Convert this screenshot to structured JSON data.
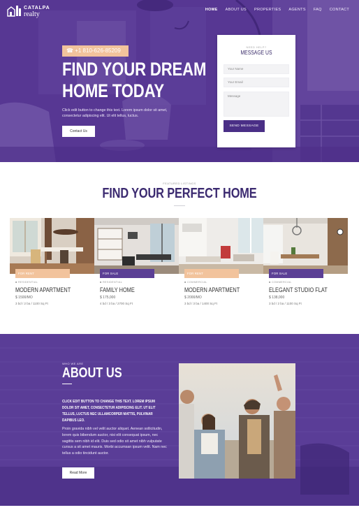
{
  "colors": {
    "brand_purple": "#4a2f86",
    "accent_peach": "#f2c39c",
    "tag_purple": "#5b3f95"
  },
  "header": {
    "logo_top": "CATALPA",
    "logo_bottom": "realty",
    "logo_icon": "house-skyline-icon",
    "nav": [
      "HOME",
      "ABOUT US",
      "PROPERTIES",
      "AGENTS",
      "FAQ",
      "CONTACT"
    ]
  },
  "hero": {
    "phone": "+1 810-626-85209",
    "title_line1": "FIND YOUR DREAM",
    "title_line2": "HOME TODAY",
    "text": "Click edit button to change this text. Lorem ipsum dolor sit amet, consectetur adipiscing elit. Ut elit tellus, luctus.",
    "button": "Contact Us"
  },
  "contact_card": {
    "kicker": "NEED HELP?",
    "title": "MESSAGE US",
    "name_placeholder": "Your Name",
    "email_placeholder": "Your Email",
    "message_placeholder": "Message",
    "send": "SEND MESSAGE"
  },
  "listings": {
    "kicker": "FEATURED LISTINGS",
    "title": "FIND YOUR PERFECT HOME",
    "cards": [
      {
        "tag": "FOR RENT",
        "type": "RESIDENTIAL",
        "name": "MODERN APARTMENT",
        "price": "$ 1500/MO",
        "specs": "3 bd / 2 ba / 1100 Sq Ft",
        "tag_color": "#f2c39c"
      },
      {
        "tag": "FOR SALE",
        "type": "RESIDENTIAL",
        "name": "FAMILY HOME",
        "price": "$ 175,000",
        "specs": "4 bd / 3 ba / 2700 Sq Ft",
        "tag_color": "#5b3f95"
      },
      {
        "tag": "FOR RENT",
        "type": "COMMERCIAL",
        "name": "MODERN APARTMENT",
        "price": "$ 2000/MO",
        "specs": "3 bd / 3 ba / 1400 Sq Ft",
        "tag_color": "#f2c39c"
      },
      {
        "tag": "FOR SALE",
        "type": "COMMERCIAL",
        "name": "ELEGANT STUDIO FLAT",
        "price": "$ 138,000",
        "specs": "3 bd / 2 ba / 1100 Sq Ft",
        "tag_color": "#5b3f95"
      }
    ]
  },
  "about": {
    "kicker": "WHO WE ARE",
    "title": "ABOUT US",
    "lead": "CLICK EDIT BUTTON TO CHANGE THIS TEXT. LOREM IPSUM DOLOR SIT AMET, CONSECTETUR ADIPISCING ELIT. UT ELIT TELLUS, LUCTUS NEC ULLAMCORPER MATTIS, PULVINAR DAPIBUS LEO.",
    "body": "Proin gravida nibh vel velit auctor aliquet. Aenean sollicitudin, lorem quis bibendum auctor, nisi elit consequat ipsum, nec sagittis sem nibh id elit. Duis sed odio sit amet nibh vulputate cursus a sit amet mauris. Morbi accumsan ipsum velit. Nam nec tellus a odio tincidunt auctor.",
    "button": "Read More"
  }
}
